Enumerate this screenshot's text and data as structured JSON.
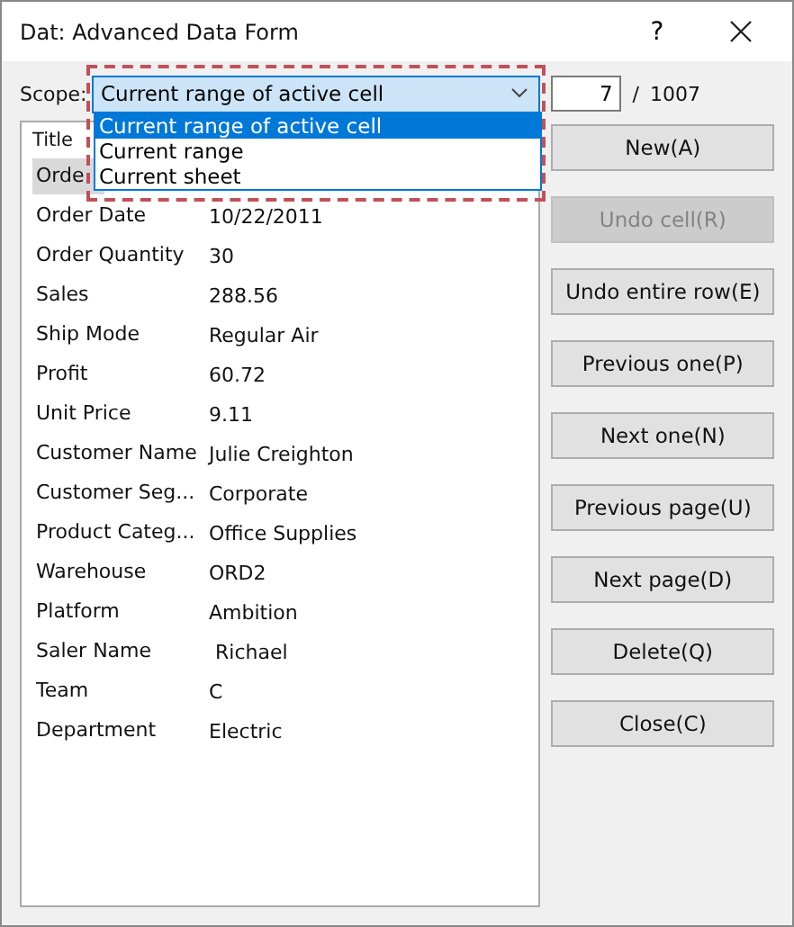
{
  "window": {
    "title": "Dat: Advanced Data Form",
    "help": "?"
  },
  "scope": {
    "label": "Scope:",
    "value": "Current range of active cell",
    "expanded": true,
    "options": [
      {
        "label": "Current range of active cell",
        "selected": true
      },
      {
        "label": "Current range",
        "selected": false
      },
      {
        "label": "Current sheet",
        "selected": false
      }
    ]
  },
  "record": {
    "value": "7",
    "separator": "/",
    "total": "1007"
  },
  "fields": {
    "header": "Title",
    "rows": [
      {
        "label": "Orde",
        "value": "",
        "selected": true
      },
      {
        "label": "Order Date",
        "value": "10/22/2011",
        "selected": false
      },
      {
        "label": "Order Quantity",
        "value": "30",
        "selected": false
      },
      {
        "label": "Sales",
        "value": "288.56",
        "selected": false
      },
      {
        "label": "Ship Mode",
        "value": "Regular Air",
        "selected": false
      },
      {
        "label": "Profit",
        "value": "60.72",
        "selected": false
      },
      {
        "label": "Unit Price",
        "value": "9.11",
        "selected": false
      },
      {
        "label": "Customer Name",
        "value": "Julie Creighton",
        "selected": false
      },
      {
        "label": "Customer Seg...",
        "value": "Corporate",
        "selected": false
      },
      {
        "label": "Product Categ...",
        "value": "Office Supplies",
        "selected": false
      },
      {
        "label": "Warehouse",
        "value": "ORD2",
        "selected": false
      },
      {
        "label": "Platform",
        "value": "Ambition",
        "selected": false
      },
      {
        "label": "Saler Name",
        "value": " Richael",
        "selected": false
      },
      {
        "label": "Team",
        "value": "C",
        "selected": false
      },
      {
        "label": "Department",
        "value": "Electric",
        "selected": false
      }
    ]
  },
  "buttons": [
    {
      "label": "New(A)",
      "disabled": false
    },
    {
      "label": "Undo cell(R)",
      "disabled": true
    },
    {
      "label": "Undo entire row(E)",
      "disabled": false
    },
    {
      "label": "Previous one(P)",
      "disabled": false
    },
    {
      "label": "Next one(N)",
      "disabled": false
    },
    {
      "label": "Previous page(U)",
      "disabled": false
    },
    {
      "label": "Next page(D)",
      "disabled": false
    },
    {
      "label": "Delete(Q)",
      "disabled": false
    },
    {
      "label": "Close(C)",
      "disabled": false
    }
  ]
}
